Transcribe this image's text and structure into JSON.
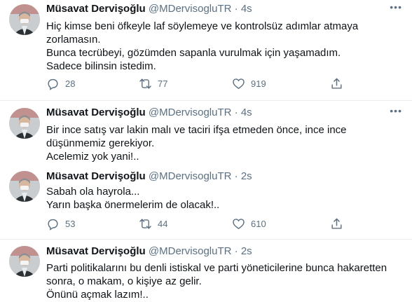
{
  "tweets": [
    {
      "name": "Müsavat Dervişoğlu",
      "handle": "@MDervisogluTR",
      "separator": "·",
      "time": "4s",
      "lines": [
        "Hiç kimse beni öfkeyle laf söylemeye ve kontrolsüz adımlar atmaya",
        "zorlamasın.",
        "Bunca tecrübeyi, gözümden sapanla vurulmak için yaşamadım.",
        "Sadece bilinsin istedim."
      ],
      "replies": "28",
      "retweets": "77",
      "likes": "919"
    },
    {
      "name": "Müsavat Dervişoğlu",
      "handle": "@MDervisogluTR",
      "separator": "·",
      "time": "4s",
      "lines": [
        "Bir ince satış var lakin malı ve taciri ifşa etmeden önce, ince ince",
        "düşünmemiz gerekiyor.",
        "Acelemiz yok yani!.."
      ]
    },
    {
      "name": "Müsavat Dervişoğlu",
      "handle": "@MDervisogluTR",
      "separator": "·",
      "time": "2s",
      "lines": [
        "Sabah ola hayrola...",
        "Yarın başka önermelerim de olacak!.."
      ],
      "replies": "53",
      "retweets": "44",
      "likes": "610"
    },
    {
      "name": "Müsavat Dervişoğlu",
      "handle": "@MDervisogluTR",
      "separator": "·",
      "time": "2s",
      "lines": [
        "Parti politikalarını bu denli istiskal ve parti yöneticilerine bunca hakaretten",
        "sonra, o makam, o kişiye az gelir.",
        "Önünü açmak lazım!.."
      ]
    }
  ],
  "icons": {
    "reply": "reply-icon",
    "retweet": "retweet-icon",
    "like": "heart-icon",
    "share": "share-icon",
    "more": "more-icon"
  },
  "colors": {
    "secondary_text": "#5b7083",
    "divider": "#ebeef0"
  }
}
